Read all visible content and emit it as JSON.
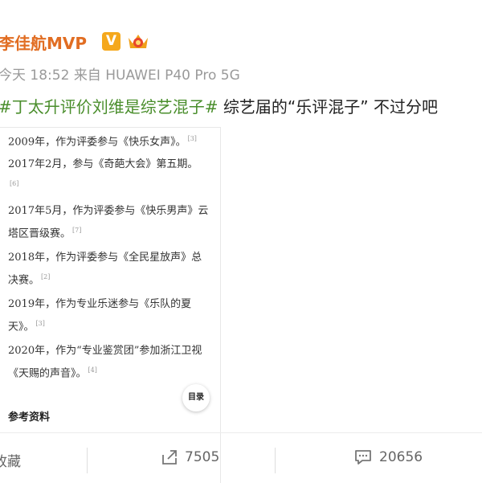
{
  "post": {
    "username": "李佳航MVP",
    "vip_badge": "V",
    "timestamp": "今天 18:52",
    "source": "来自 HUAWEI P40 Pro 5G",
    "hashtag": "#丁太升评价刘维是综艺混子#",
    "text": " 综艺届的“乐评混子” 不过分吧"
  },
  "card": {
    "entries": [
      {
        "text": "2009年，作为评委参与《快乐女声》。",
        "ref": "[3]"
      },
      {
        "text": "2017年2月，参与《奇葩大会》第五期。",
        "ref": "[6]"
      },
      {
        "text": "2017年5月，作为评委参与《快乐男声》云塔区晋级赛。",
        "ref": "[7]"
      },
      {
        "text": "2018年，作为评委参与《全民星放声》总决赛。",
        "ref": "[2]"
      },
      {
        "text": "2019年，作为专业乐迷参与《乐队的夏天》。",
        "ref": "[3]"
      },
      {
        "text": "2020年，作为“专业鉴赏团”参加浙江卫视《天赐的声音》。",
        "ref": "[4]"
      }
    ],
    "toc_label": "目录",
    "refs_title": "参考资料"
  },
  "actions": {
    "collect_label": "收藏",
    "repost_count": "7505",
    "comment_count": "20656"
  },
  "colors": {
    "username": "#e16d22",
    "hashtag": "#4a8e2c",
    "link": "#4a6ec6"
  }
}
